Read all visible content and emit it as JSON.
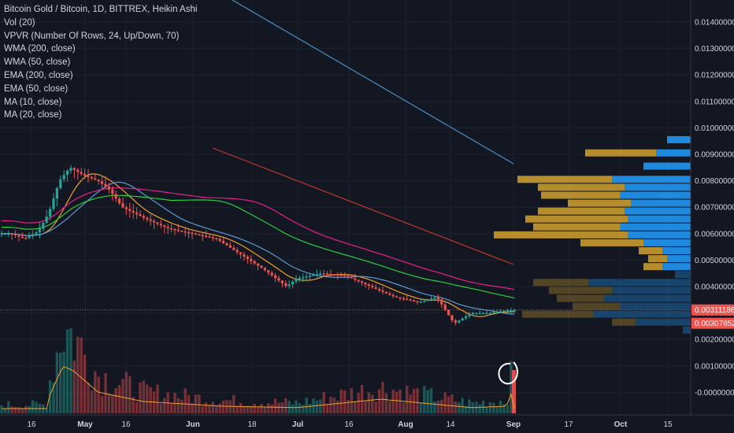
{
  "legend": {
    "title": "Bitcoin Gold / Bitcoin, 1D, BITTREX, Heikin Ashi",
    "indicators": [
      "Vol (20)",
      "VPVR (Number Of Rows, 24, Up/Down, 70)",
      "WMA (200, close)",
      "WMA (50, close)",
      "EMA (200, close)",
      "EMA (50, close)",
      "MA (10, close)",
      "MA (20, close)"
    ]
  },
  "colors": {
    "background": "#131722",
    "up_candle": "#26a69a",
    "down_candle": "#ef5350",
    "vpvr_up": "#2196f3",
    "vpvr_down": "#c99a2e",
    "wma200": "#4a90c8",
    "wma50": "#c0392b",
    "ema200": "#e91e8c",
    "ema50": "#2ecc40",
    "ma10": "#f0a030",
    "ma20": "#5b9bd5",
    "price_line": "#ef5350"
  },
  "chart_data": {
    "type": "candlestick",
    "symbol": "Bitcoin Gold / Bitcoin",
    "timeframe": "1D",
    "exchange": "BITTREX",
    "candle_style": "Heikin Ashi",
    "y_axis": {
      "ticks": [
        "0.01400000",
        "0.01300000",
        "0.01200000",
        "0.01100000",
        "0.01000000",
        "0.00900000",
        "0.00800000",
        "0.00700000",
        "0.00600000",
        "0.00500000",
        "0.00400000",
        "0.00300000",
        "0.00200000",
        "0.00100000",
        "-0.00000000"
      ],
      "price_ticks_range": [
        0.002,
        0.014
      ],
      "current_price": "0.00311186",
      "second_price": "0.00307852"
    },
    "x_axis": {
      "ticks": [
        "16",
        "May",
        "16",
        "Jun",
        "18",
        "Jul",
        "16",
        "Aug",
        "14",
        "Sep",
        "17",
        "Oct",
        "15"
      ],
      "bold": [
        "May",
        "Jun",
        "Jul",
        "Aug",
        "Sep",
        "Oct"
      ]
    },
    "price_series": [
      {
        "date": "Apr 10",
        "value": 0.006
      },
      {
        "date": "Apr 14",
        "value": 0.0058
      },
      {
        "date": "Apr 18",
        "value": 0.0061
      },
      {
        "date": "Apr 21",
        "value": 0.0068
      },
      {
        "date": "Apr 24",
        "value": 0.008
      },
      {
        "date": "Apr 27",
        "value": 0.0085
      },
      {
        "date": "May 1",
        "value": 0.0082
      },
      {
        "date": "May 5",
        "value": 0.008
      },
      {
        "date": "May 8",
        "value": 0.0077
      },
      {
        "date": "May 12",
        "value": 0.007
      },
      {
        "date": "May 18",
        "value": 0.0066
      },
      {
        "date": "May 25",
        "value": 0.0062
      },
      {
        "date": "Jun 1",
        "value": 0.006
      },
      {
        "date": "Jun 8",
        "value": 0.0058
      },
      {
        "date": "Jun 15",
        "value": 0.0052
      },
      {
        "date": "Jun 22",
        "value": 0.0046
      },
      {
        "date": "Jun 28",
        "value": 0.004
      },
      {
        "date": "Jul 1",
        "value": 0.0043
      },
      {
        "date": "Jul 8",
        "value": 0.0045
      },
      {
        "date": "Jul 15",
        "value": 0.0044
      },
      {
        "date": "Jul 22",
        "value": 0.004
      },
      {
        "date": "Jul 29",
        "value": 0.0036
      },
      {
        "date": "Aug 5",
        "value": 0.0034
      },
      {
        "date": "Aug 10",
        "value": 0.0036
      },
      {
        "date": "Aug 15",
        "value": 0.0026
      },
      {
        "date": "Aug 20",
        "value": 0.003
      },
      {
        "date": "Aug 25",
        "value": 0.003
      },
      {
        "date": "Aug 30",
        "value": 0.0031
      },
      {
        "date": "Sep 1",
        "value": 0.0031
      }
    ],
    "volume_relative": [
      {
        "date": "Apr 21",
        "value": 0.35
      },
      {
        "date": "Apr 25",
        "value": 1.0
      },
      {
        "date": "Apr 28",
        "value": 0.9
      },
      {
        "date": "May 5",
        "value": 0.45
      },
      {
        "date": "May 18",
        "value": 0.25
      },
      {
        "date": "Jun 10",
        "value": 0.15
      },
      {
        "date": "Jul 1",
        "value": 0.12
      },
      {
        "date": "Jul 25",
        "value": 0.3
      },
      {
        "date": "Aug 20",
        "value": 0.12
      },
      {
        "date": "Aug 30",
        "value": 0.15
      },
      {
        "date": "Sep 1",
        "value": 0.55
      }
    ],
    "vpvr_rows": [
      {
        "price": 0.00955,
        "up": 0.15,
        "down": 0.0
      },
      {
        "price": 0.00905,
        "up": 0.22,
        "down": 0.45
      },
      {
        "price": 0.00855,
        "up": 0.3,
        "down": 0.0
      },
      {
        "price": 0.00805,
        "up": 0.5,
        "down": 0.6
      },
      {
        "price": 0.00775,
        "up": 0.42,
        "down": 0.55
      },
      {
        "price": 0.00745,
        "up": 0.45,
        "down": 0.5
      },
      {
        "price": 0.00715,
        "up": 0.38,
        "down": 0.4
      },
      {
        "price": 0.00685,
        "up": 0.42,
        "down": 0.55
      },
      {
        "price": 0.00655,
        "up": 0.4,
        "down": 0.65
      },
      {
        "price": 0.00625,
        "up": 0.45,
        "down": 0.55
      },
      {
        "price": 0.00595,
        "up": 0.4,
        "down": 0.85
      },
      {
        "price": 0.00565,
        "up": 0.3,
        "down": 0.4
      },
      {
        "price": 0.00535,
        "up": 0.18,
        "down": 0.15
      },
      {
        "price": 0.00505,
        "up": 0.15,
        "down": 0.12
      },
      {
        "price": 0.00475,
        "up": 0.18,
        "down": 0.12
      },
      {
        "price": 0.00445,
        "up": 0.1,
        "down": 0.0
      },
      {
        "price": 0.00415,
        "up": 0.65,
        "down": 0.35
      },
      {
        "price": 0.00385,
        "up": 0.5,
        "down": 0.4
      },
      {
        "price": 0.00355,
        "up": 0.55,
        "down": 0.3
      },
      {
        "price": 0.00325,
        "up": 0.45,
        "down": 0.3
      },
      {
        "price": 0.00295,
        "up": 0.62,
        "down": 0.45
      },
      {
        "price": 0.00265,
        "up": 0.35,
        "down": 0.15
      },
      {
        "price": 0.00235,
        "up": 0.05,
        "down": 0.0
      }
    ]
  }
}
